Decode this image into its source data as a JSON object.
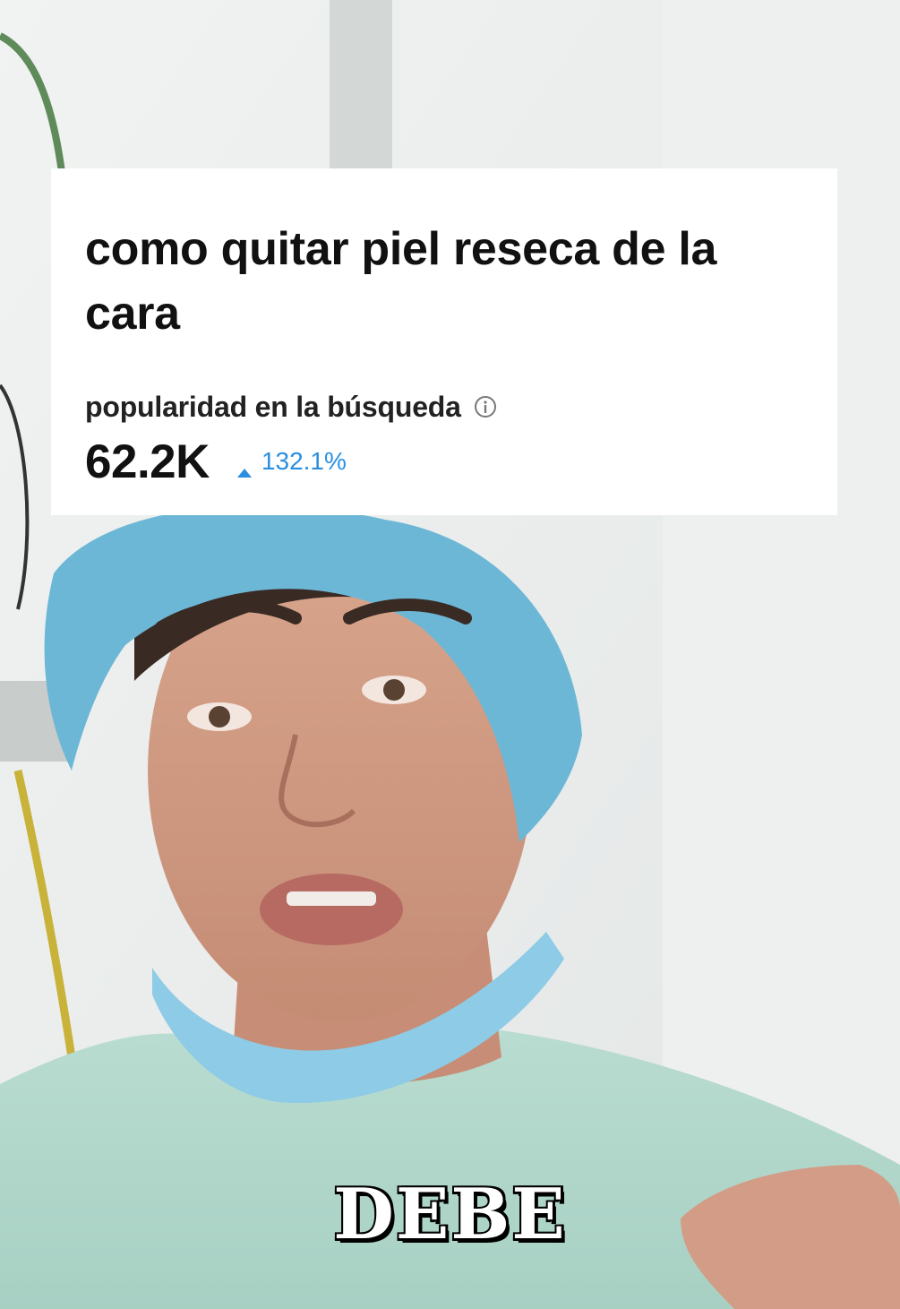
{
  "search_card": {
    "title": "como quitar piel reseca de la cara",
    "popularity_label": "popularidad en la búsqueda",
    "popularity_value": "62.2K",
    "trend_percent": "132.1%",
    "trend_direction": "up",
    "info_icon": "info-icon",
    "trend_icon": "triangle-up-icon",
    "trend_color": "#2a8fe0"
  },
  "video": {
    "caption": "DEBE"
  }
}
